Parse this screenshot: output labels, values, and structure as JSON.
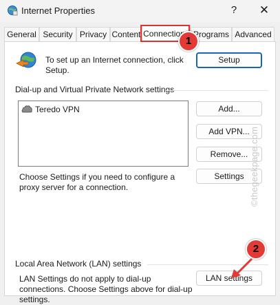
{
  "window": {
    "title": "Internet Properties",
    "help_label": "?",
    "close_label": "✕"
  },
  "tabs": [
    {
      "label": "General"
    },
    {
      "label": "Security"
    },
    {
      "label": "Privacy"
    },
    {
      "label": "Content"
    },
    {
      "label": "Connections",
      "active": true
    },
    {
      "label": "Programs"
    },
    {
      "label": "Advanced"
    }
  ],
  "setup": {
    "text": "To set up an Internet connection, click Setup.",
    "button_label": "Setup"
  },
  "vpn_section": {
    "title": "Dial-up and Virtual Private Network settings",
    "items": [
      {
        "label": "Teredo VPN"
      }
    ],
    "add_label": "Add...",
    "add_vpn_label": "Add VPN...",
    "remove_label": "Remove...",
    "settings_label": "Settings",
    "proxy_text": "Choose Settings if you need to configure a proxy server for a connection."
  },
  "lan_section": {
    "title": "Local Area Network (LAN) settings",
    "text": "LAN Settings do not apply to dial-up connections. Choose Settings above for dial-up settings.",
    "button_label": "LAN settings"
  },
  "annotations": {
    "step1": "1",
    "step2": "2",
    "highlight_color": "#e03030",
    "callout_color": "#e23a36"
  },
  "watermark": "©thegeekpage.com",
  "colors": {
    "primary_button_border": "#1a64b5"
  }
}
